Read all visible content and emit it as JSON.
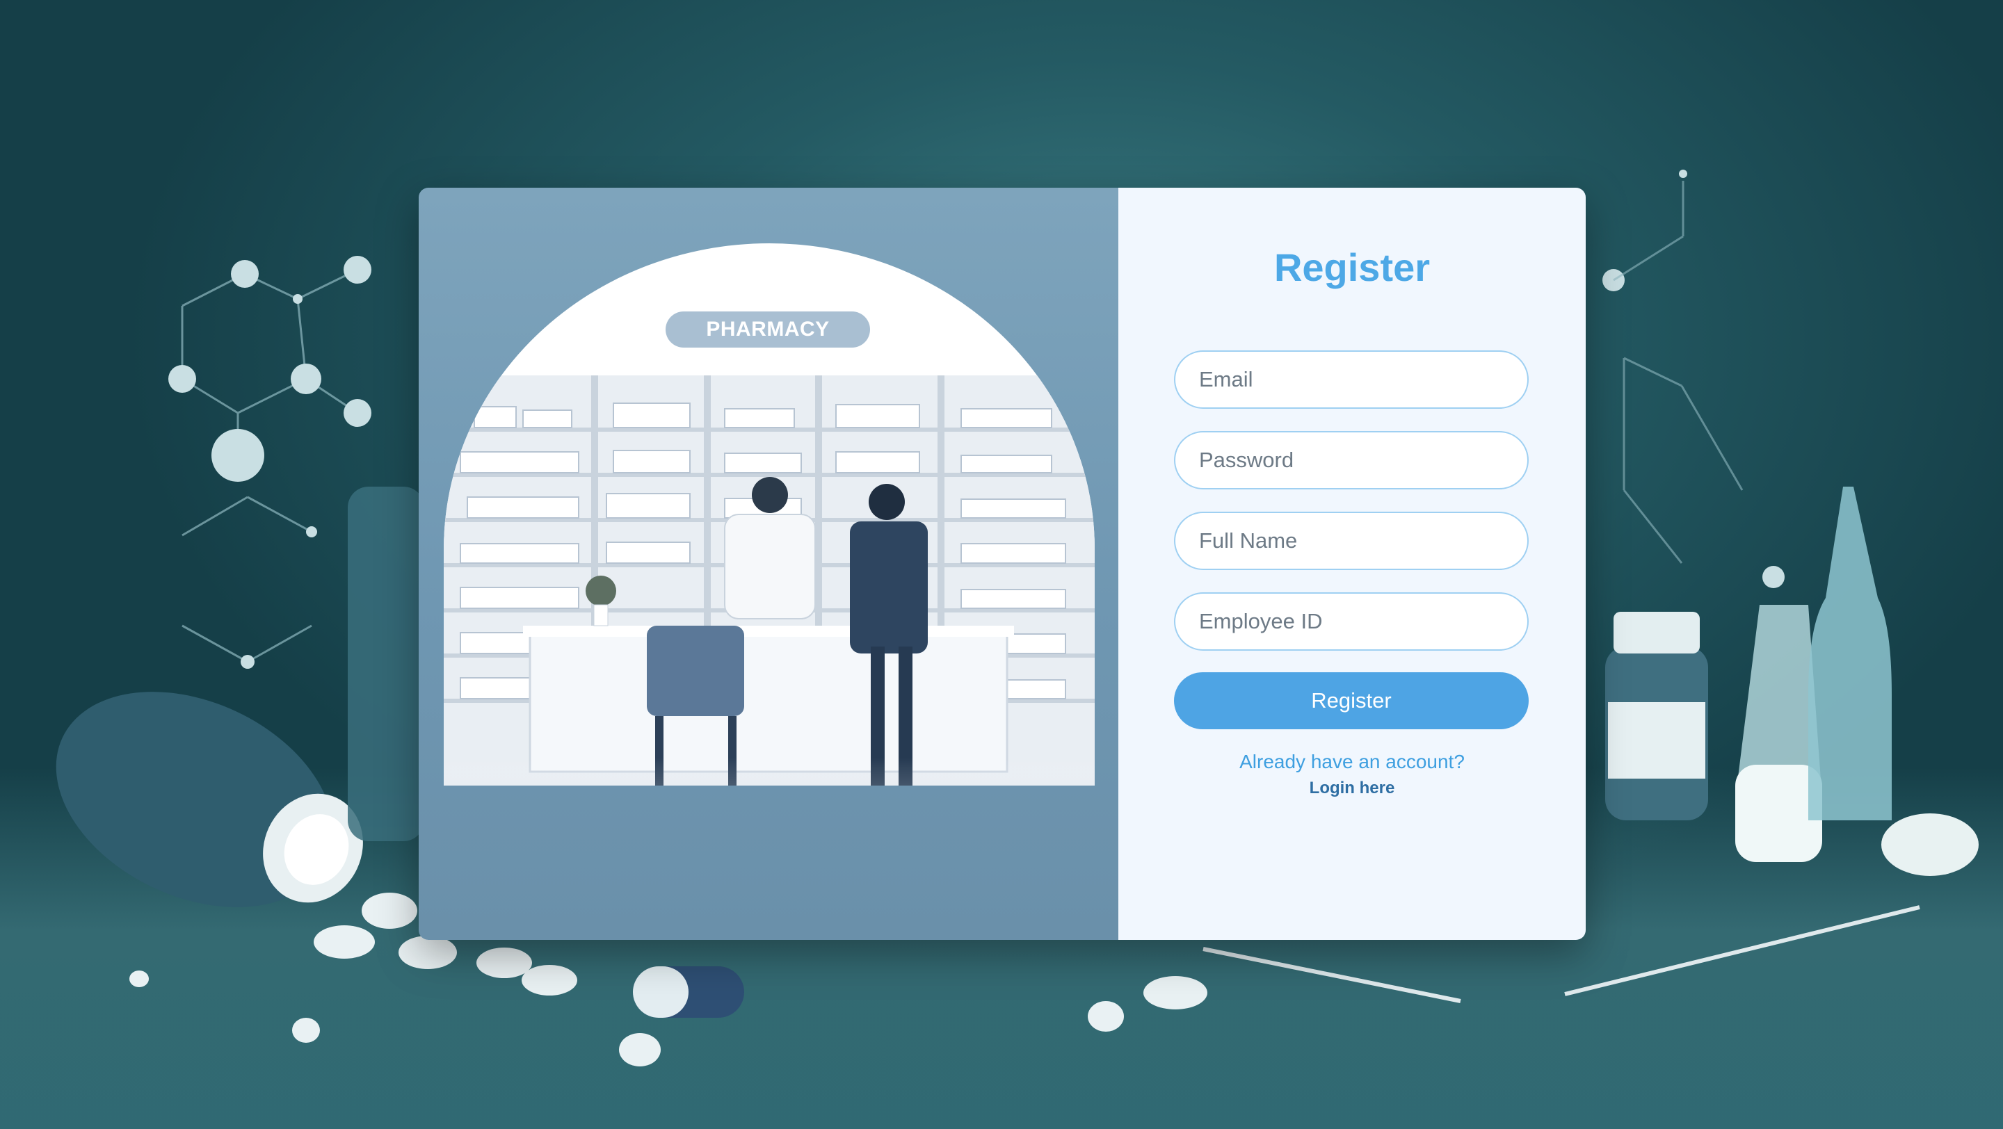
{
  "illustration": {
    "sign_text": "PHARMACY"
  },
  "form": {
    "title": "Register",
    "email_placeholder": "Email",
    "password_placeholder": "Password",
    "full_name_placeholder": "Full Name",
    "employee_id_placeholder": "Employee ID",
    "submit_label": "Register",
    "already_text": "Already have an account?",
    "login_link": "Login here"
  },
  "colors": {
    "accent": "#4ea4e4",
    "title": "#4da8e6",
    "panel": "#f1f7fe",
    "illustration_bg": "#7ea4bc"
  }
}
